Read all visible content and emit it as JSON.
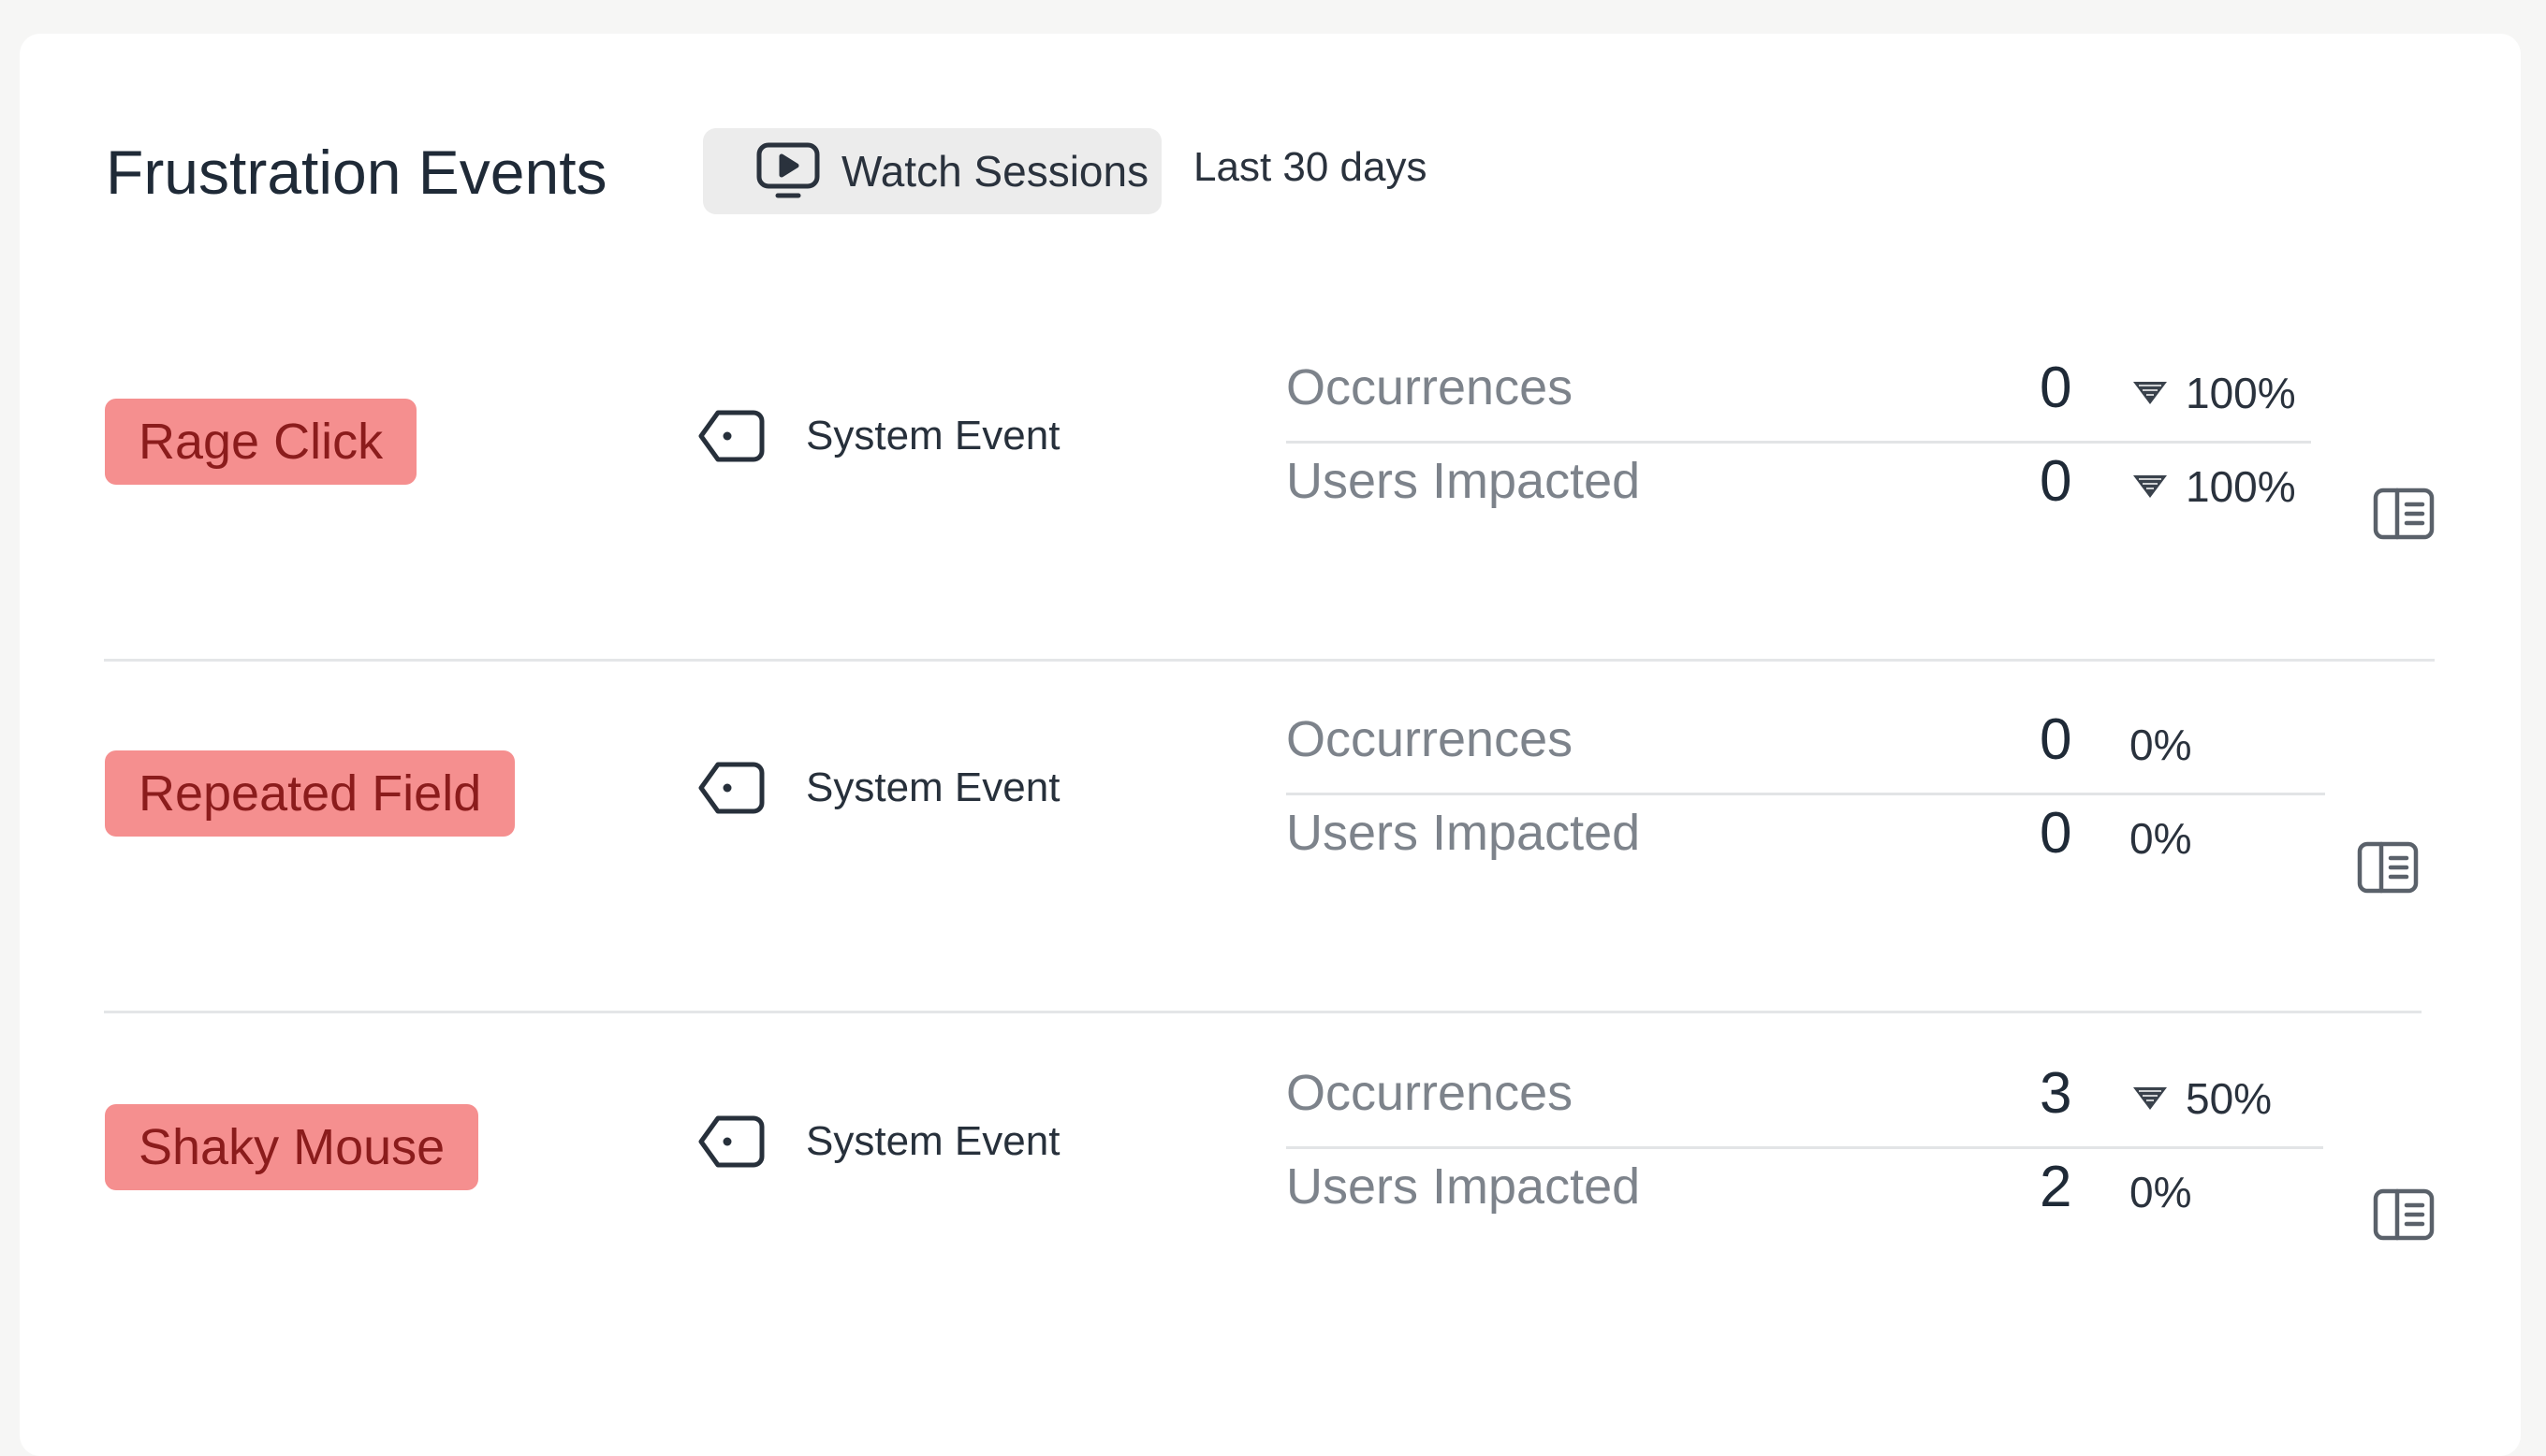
{
  "header": {
    "title": "Frustration Events",
    "watch_sessions_label": "Watch Sessions",
    "date_range": "Last 30 days"
  },
  "events": [
    {
      "name": "Rage Click",
      "type_label": "System Event",
      "occurrences": {
        "label": "Occurrences",
        "value": "0",
        "change": "100%",
        "change_icon": "triangle-down-icon"
      },
      "users_impacted": {
        "label": "Users Impacted",
        "value": "0",
        "change": "100%",
        "change_icon": "triangle-down-icon"
      }
    },
    {
      "name": "Repeated Field",
      "type_label": "System Event",
      "occurrences": {
        "label": "Occurrences",
        "value": "0",
        "change": "0%",
        "change_icon": null
      },
      "users_impacted": {
        "label": "Users Impacted",
        "value": "0",
        "change": "0%",
        "change_icon": null
      }
    },
    {
      "name": "Shaky Mouse",
      "type_label": "System Event",
      "occurrences": {
        "label": "Occurrences",
        "value": "3",
        "change": "50%",
        "change_icon": "triangle-down-icon"
      },
      "users_impacted": {
        "label": "Users Impacted",
        "value": "2",
        "change": "0%",
        "change_icon": null
      }
    }
  ],
  "icons": {
    "watch": "monitor-play-icon",
    "event_type": "tag-icon",
    "details": "sidebar-panel-icon"
  },
  "colors": {
    "tag_background": "#f58f8f",
    "tag_text": "#8b1c1c",
    "muted_text": "#7d838b"
  }
}
